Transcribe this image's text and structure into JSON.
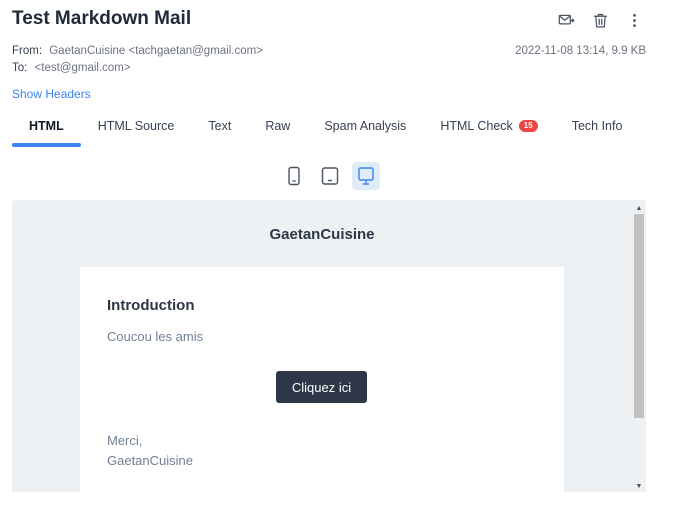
{
  "header": {
    "title": "Test Markdown Mail",
    "actions": [
      {
        "icon": "mail-forward-icon"
      },
      {
        "icon": "trash-icon"
      },
      {
        "icon": "more-vertical-icon"
      }
    ]
  },
  "meta": {
    "from_label": "From:",
    "from_value": "GaetanCuisine <tachgaetan@gmail.com>",
    "to_label": "To:",
    "to_value": "<test@gmail.com>",
    "date_size": "2022-11-08 13:14, 9.9 KB"
  },
  "show_headers": "Show Headers",
  "tabs": [
    {
      "label": "HTML",
      "active": true
    },
    {
      "label": "HTML Source"
    },
    {
      "label": "Text"
    },
    {
      "label": "Raw"
    },
    {
      "label": "Spam Analysis"
    },
    {
      "label": "HTML Check",
      "badge": "15"
    },
    {
      "label": "Tech Info"
    }
  ],
  "devices": [
    {
      "icon": "phone-icon"
    },
    {
      "icon": "tablet-icon"
    },
    {
      "icon": "desktop-icon",
      "active": true
    }
  ],
  "email": {
    "brand": "GaetanCuisine",
    "heading": "Introduction",
    "intro": "Coucou les amis",
    "button_label": "Cliquez ici",
    "sign_line1": "Merci,",
    "sign_line2": "GaetanCuisine"
  },
  "colors": {
    "accent": "#3b82f6",
    "badge": "#ef4444",
    "button_bg": "#2d3748",
    "preview_bg": "#eef1f4"
  }
}
